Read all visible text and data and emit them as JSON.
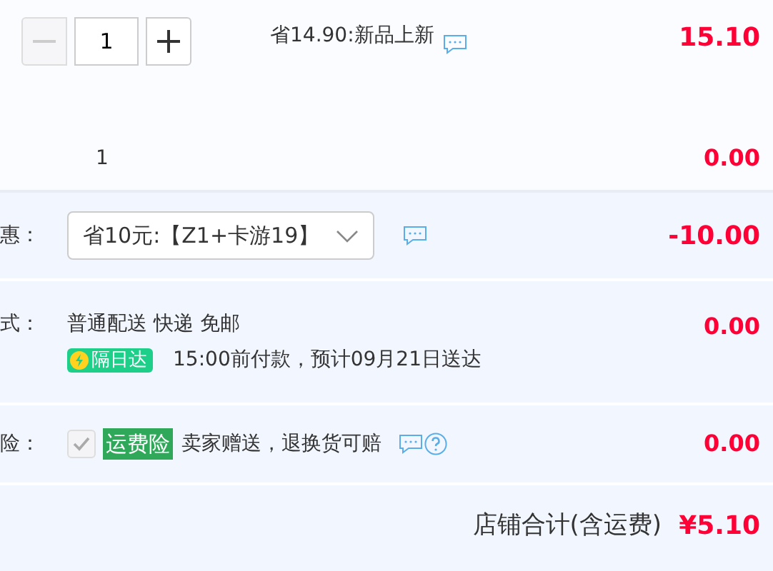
{
  "item": {
    "quantity": "1",
    "minus_disabled": true,
    "promotion": "省14.90:新品上新",
    "price": "15.10",
    "sub_quantity": "1",
    "sub_price": "0.00"
  },
  "discount": {
    "label": "惠：",
    "selected_option": "省10元:【Z1+卡游19】",
    "amount": "-10.00"
  },
  "delivery": {
    "label": "式：",
    "method": "普通配送 快递 免邮",
    "badge": "隔日达",
    "note": "15:00前付款，预计09月21日送达",
    "amount": "0.00"
  },
  "insurance": {
    "label": "险：",
    "checked": true,
    "disabled": true,
    "tag": "运费险",
    "text": "卖家赠送，退换货可赔",
    "amount": "0.00"
  },
  "total": {
    "label": "店铺合计(含运费)",
    "amount": "¥5.10"
  }
}
